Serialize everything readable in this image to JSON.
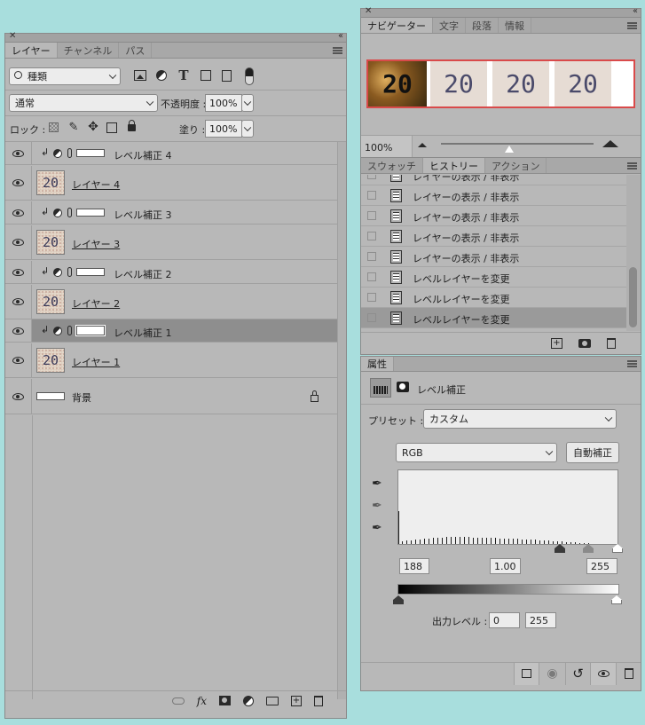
{
  "layers_panel": {
    "tabs": [
      "レイヤー",
      "チャンネル",
      "パス"
    ],
    "filter_kind": "種類",
    "blend_mode": "通常",
    "opacity_label": "不透明度 :",
    "opacity_value": "100%",
    "lock_label": "ロック :",
    "fill_label": "塗り :",
    "fill_value": "100%",
    "layers": [
      {
        "name": "レベル補正 4",
        "type": "adjustment"
      },
      {
        "name": "レイヤー 4",
        "type": "pixel",
        "thumb_text": "20"
      },
      {
        "name": "レベル補正 3",
        "type": "adjustment"
      },
      {
        "name": "レイヤー 3",
        "type": "pixel",
        "thumb_text": "20"
      },
      {
        "name": "レベル補正 2",
        "type": "adjustment"
      },
      {
        "name": "レイヤー 2",
        "type": "pixel",
        "thumb_text": "20"
      },
      {
        "name": "レベル補正 1",
        "type": "adjustment",
        "selected": true
      },
      {
        "name": "レイヤー 1",
        "type": "pixel",
        "thumb_text": "20"
      },
      {
        "name": "背景",
        "type": "background",
        "locked": true
      }
    ],
    "bottom_icons": [
      "link-icon",
      "fx-icon",
      "mask-icon",
      "adjustment-icon",
      "folder-icon",
      "new-layer-icon",
      "trash-icon"
    ],
    "fx_label": "fx"
  },
  "navigator_panel": {
    "tabs": [
      "ナビゲーター",
      "文字",
      "段落",
      "情報"
    ],
    "preview_text": [
      "20",
      "20",
      "20",
      "20"
    ],
    "zoom_value": "100%",
    "zoom_slider_level": 0.45
  },
  "history_panel": {
    "tabs": [
      "スウォッチ",
      "ヒストリー",
      "アクション"
    ],
    "items": [
      "レイヤーの表示 / 非表示",
      "レイヤーの表示 / 非表示",
      "レイヤーの表示 / 非表示",
      "レイヤーの表示 / 非表示",
      "レイヤーの表示 / 非表示",
      "レベルレイヤーを変更",
      "レベルレイヤーを変更",
      "レベルレイヤーを変更"
    ],
    "selected_index": 7
  },
  "properties_panel": {
    "tab": "属性",
    "title": "レベル補正",
    "preset_label": "プリセット :",
    "preset_value": "カスタム",
    "channel_value": "RGB",
    "auto_button": "自動補正",
    "input_black": "188",
    "input_gamma": "1.00",
    "input_white": "255",
    "output_label": "出力レベル :",
    "output_black": "0",
    "output_white": "255"
  }
}
